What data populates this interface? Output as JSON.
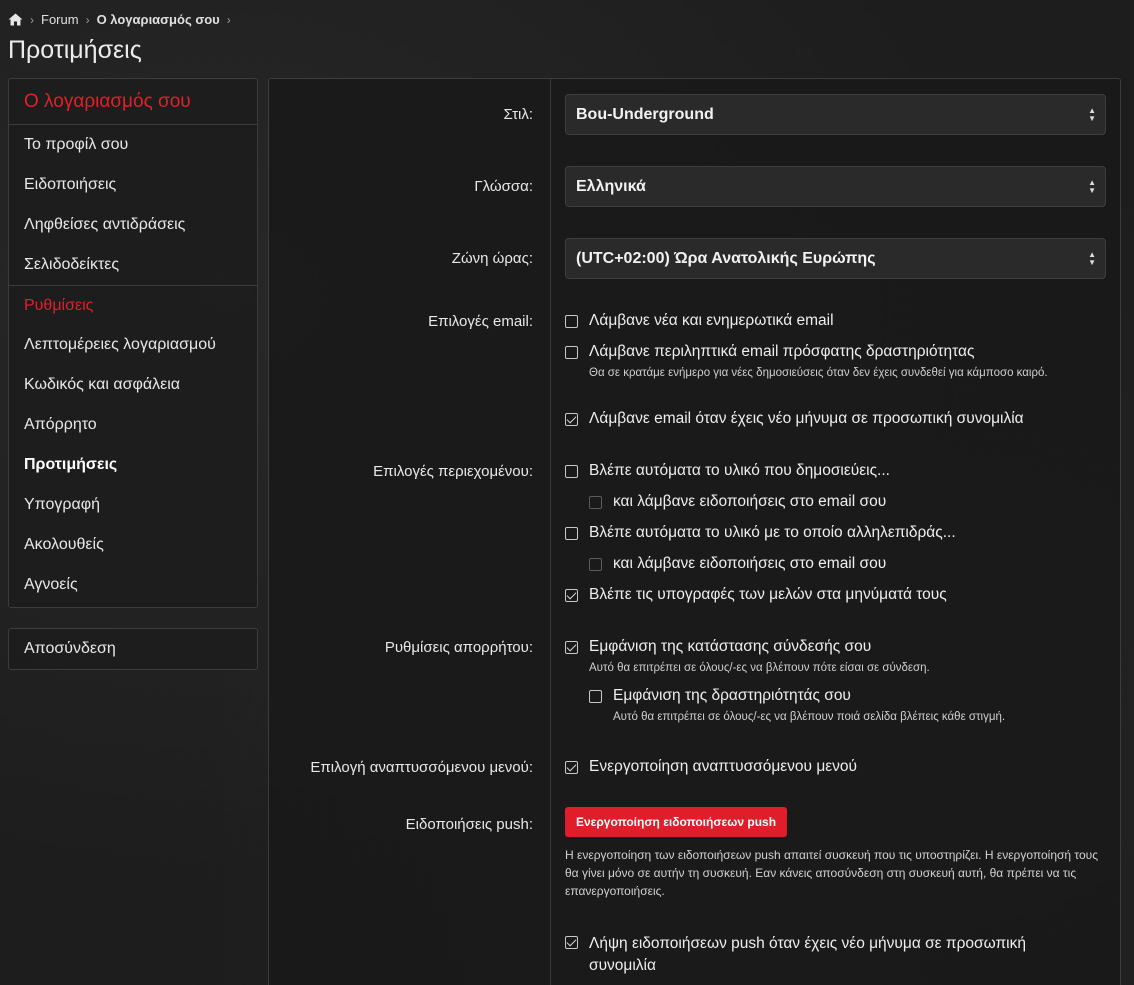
{
  "breadcrumb": {
    "items": [
      "Forum",
      "Ο λογαριασμός σου"
    ]
  },
  "page_title": "Προτιμήσεις",
  "sidebar": {
    "header": "Ο λογαριασμός σου",
    "account_items": [
      "Το προφίλ σου",
      "Ειδοποιήσεις",
      "Ληφθείσες αντιδράσεις",
      "Σελιδοδείκτες"
    ],
    "settings_header": "Ρυθμίσεις",
    "settings_items": [
      "Λεπτομέρειες λογαριασμού",
      "Κωδικός και ασφάλεια",
      "Απόρρητο",
      "Προτιμήσεις",
      "Υπογραφή",
      "Ακολουθείς",
      "Αγνοείς"
    ],
    "active_item": "Προτιμήσεις",
    "logout": "Αποσύνδεση"
  },
  "form": {
    "style": {
      "label": "Στιλ:",
      "value": "Bou-Underground"
    },
    "language": {
      "label": "Γλώσσα:",
      "value": "Ελληνικά"
    },
    "timezone": {
      "label": "Ζώνη ώρας:",
      "value": "(UTC+02:00) Ώρα Ανατολικής Ευρώπης"
    },
    "email_options": {
      "label": "Επιλογές email:",
      "items": [
        {
          "text": "Λάμβανε νέα και ενημερωτικά email",
          "checked": false
        },
        {
          "text": "Λάμβανε περιληπτικά email πρόσφατης δραστηριότητας",
          "hint": "Θα σε κρατάμε ενήμερο για νέες δημοσιεύσεις όταν δεν έχεις συνδεθεί για κάμποσο καιρό.",
          "checked": false
        },
        {
          "text": "Λάμβανε email όταν έχεις νέο μήνυμα σε προσωπική συνομιλία",
          "checked": true
        }
      ]
    },
    "content_options": {
      "label": "Επιλογές περιεχομένου:",
      "items": [
        {
          "text": "Βλέπε αυτόματα το υλικό που δημοσιεύεις...",
          "checked": false
        },
        {
          "text": "και λάμβανε ειδοποιήσεις στο email σου",
          "checked": false,
          "disabled": true
        },
        {
          "text": "Βλέπε αυτόματα το υλικό με το οποίο αλληλεπιδράς...",
          "checked": false
        },
        {
          "text": "και λάμβανε ειδοποιήσεις στο email σου",
          "checked": false,
          "disabled": true
        },
        {
          "text": "Βλέπε τις υπογραφές των μελών στα μηνύματά τους",
          "checked": true
        }
      ]
    },
    "privacy": {
      "label": "Ρυθμίσεις απορρήτου:",
      "items": [
        {
          "text": "Εμφάνιση της κατάστασης σύνδεσής σου",
          "hint": "Αυτό θα επιτρέπει σε όλους/-ες να βλέπουν πότε είσαι σε σύνδεση.",
          "checked": true
        },
        {
          "text": "Εμφάνιση της δραστηριότητάς σου",
          "hint": "Αυτό θα επιτρέπει σε όλους/-ες να βλέπουν ποιά σελίδα βλέπεις κάθε στιγμή.",
          "checked": false
        }
      ]
    },
    "dropdown_menu": {
      "label": "Επιλογή αναπτυσσόμενου μενού:",
      "text": "Ενεργοποίηση αναπτυσσόμενου μενού",
      "checked": true
    },
    "push": {
      "label": "Ειδοποιήσεις push:",
      "button": "Ενεργοποίηση ειδοποιήσεων push",
      "hint": "Η ενεργοποίηση των ειδοποιήσεων push απαιτεί συσκευή που τις υποστηρίζει. Η ενεργοποίησή τους θα γίνει μόνο σε αυτήν τη συσκευή. Εαν κάνεις αποσύνδεση στη συσκευή αυτή, θα πρέπει να τις επανεργοποιήσεις.",
      "check_text": "Λήψη ειδοποιήσεων push όταν έχεις νέο μήνυμα σε προσωπική συνομιλία",
      "checked": true
    }
  },
  "colors": {
    "accent": "#e0202a",
    "background": "#1d1d1d",
    "panel_border": "#3c3c3c"
  },
  "icons": {
    "home": "home-icon",
    "separator": "chevron-right-icon",
    "select_arrows": "up-down-arrows-icon"
  }
}
